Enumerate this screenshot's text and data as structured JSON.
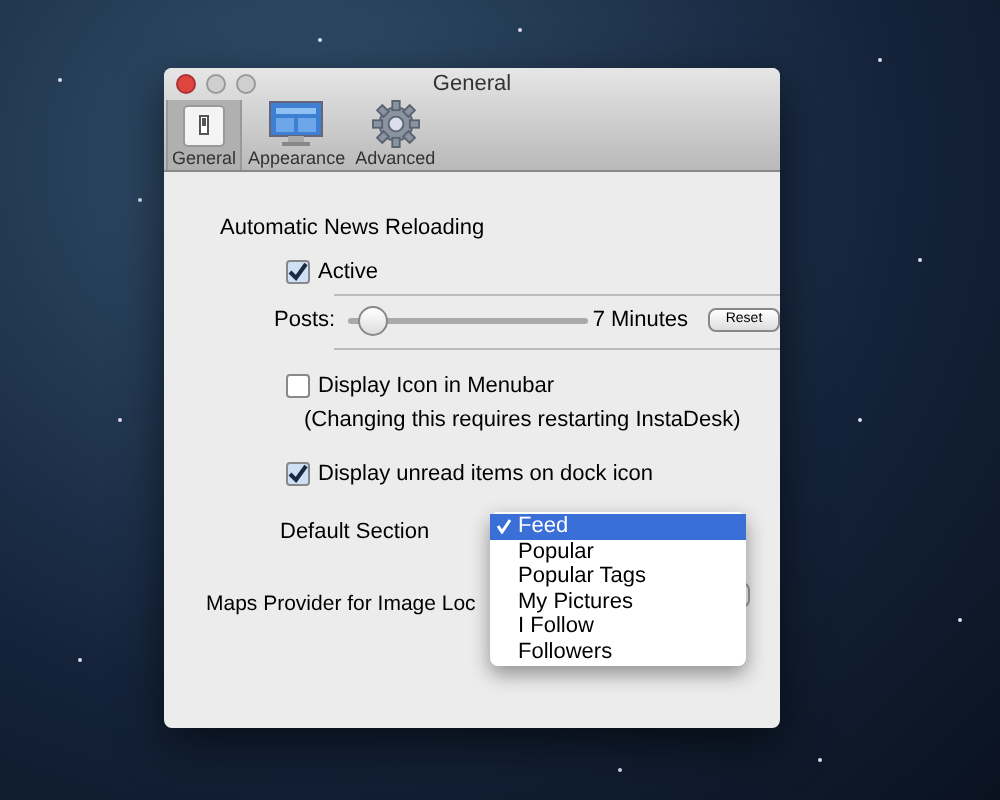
{
  "window": {
    "title": "General"
  },
  "toolbar": {
    "tabs": [
      {
        "label": "General",
        "kind": "general",
        "selected": true
      },
      {
        "label": "Appearance",
        "kind": "appearance",
        "selected": false
      },
      {
        "label": "Advanced",
        "kind": "advanced",
        "selected": false
      }
    ]
  },
  "heading": "Automatic News Reloading",
  "active": {
    "label": "Active",
    "checked": true
  },
  "posts": {
    "label": "Posts:",
    "level": 0.1,
    "reading": "7 Minutes",
    "button": "Reset"
  },
  "menubar_icon": {
    "label": "Display Icon in Menubar",
    "checked": false,
    "note": "(Changing this requires restarting InstaDesk)"
  },
  "dock_icon": {
    "label": "Display unread items on dock icon",
    "checked": true
  },
  "default_section": {
    "label": "Default Section",
    "menu": [
      {
        "label": "Feed",
        "selected": true
      },
      {
        "label": "Popular",
        "selected": false
      },
      {
        "label": "Popular Tags",
        "selected": false
      },
      {
        "label": "My Pictures",
        "selected": false
      },
      {
        "label": "I Follow",
        "selected": false
      },
      {
        "label": "Followers",
        "selected": false
      }
    ]
  },
  "maps_provider": {
    "label": "Maps Provider for Image Loc"
  }
}
